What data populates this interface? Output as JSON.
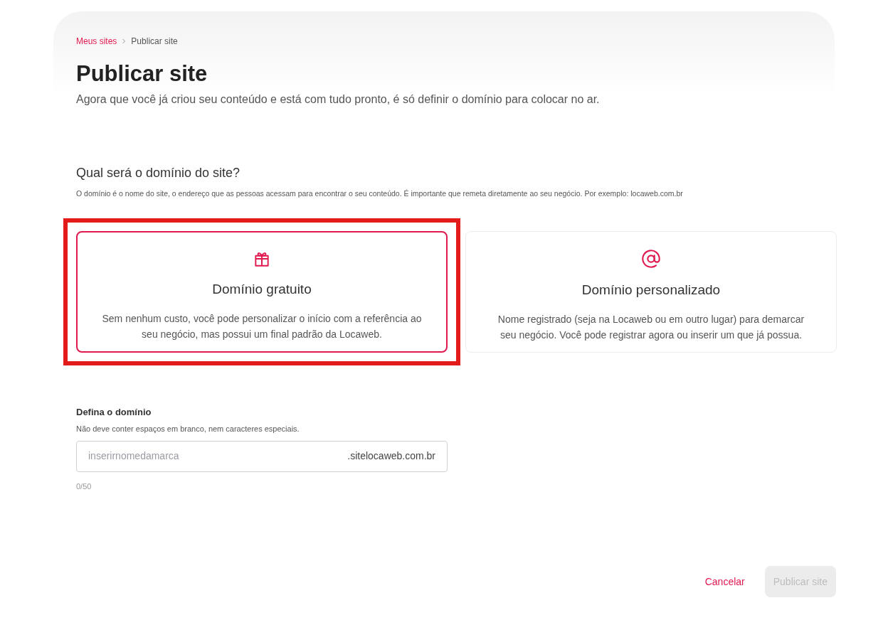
{
  "breadcrumb": [
    {
      "label": "Meus sites",
      "kind": "link"
    },
    {
      "label": "Publicar site",
      "kind": "current"
    }
  ],
  "title": "Publicar site",
  "subtitle": "Agora que você já criou seu conteúdo e está com tudo pronto, é só definir o domínio para colocar no ar.",
  "question": {
    "title": "Qual será o domínio do site?",
    "description": "O domínio é o nome do site, o endereço que as pessoas acessam para encontrar o seu conteúdo. É importante que remeta diretamente ao seu negócio. Por exemplo: locaweb.com.br"
  },
  "options": [
    {
      "kind": "gift",
      "title": "Domínio gratuito",
      "description": "Sem nenhum custo, você pode personalizar o início com a referência ao seu negócio, mas possui um final padrão da Locaweb.",
      "selected": true,
      "highlighted": true
    },
    {
      "kind": "at",
      "title": "Domínio personalizado",
      "description": "Nome registrado (seja na Locaweb ou em outro lugar) para demarcar seu negócio. Você pode registrar agora ou inserir um que já possua.",
      "selected": false,
      "highlighted": false
    }
  ],
  "domain_field": {
    "label": "Defina o domínio",
    "hint": "Não deve conter espaços em branco, nem caracteres especiais.",
    "placeholder": "inserirnomedamarca",
    "suffix": ".sitelocaweb.com.br",
    "counter": "0/50"
  },
  "actions": {
    "cancel": "Cancelar",
    "publish": {
      "label": "Publicar site",
      "disabled": true
    }
  }
}
